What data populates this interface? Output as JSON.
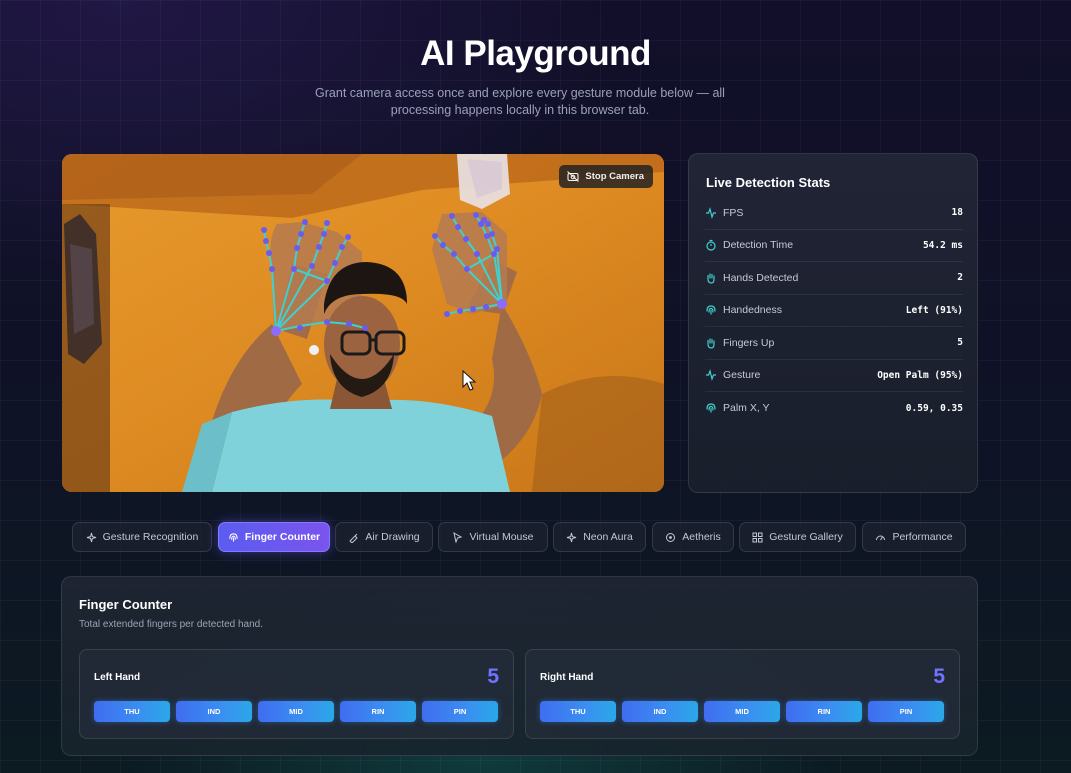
{
  "header": {
    "title": "AI Playground",
    "subtitle": "Grant camera access once and explore every gesture module below — all processing happens locally in this browser tab."
  },
  "camera": {
    "stop_label": "Stop Camera",
    "stop_icon": "camera-off-icon"
  },
  "stats": {
    "title": "Live Detection Stats",
    "rows": [
      {
        "label": "FPS",
        "value": "18",
        "icon": "activity-icon"
      },
      {
        "label": "Detection Time",
        "value": "54.2 ms",
        "icon": "timer-icon"
      },
      {
        "label": "Hands Detected",
        "value": "2",
        "icon": "hand-icon"
      },
      {
        "label": "Handedness",
        "value": "Left (91%)",
        "icon": "fingerprint-icon"
      },
      {
        "label": "Fingers Up",
        "value": "5",
        "icon": "hand-icon"
      },
      {
        "label": "Gesture",
        "value": "Open Palm (95%)",
        "icon": "activity-icon"
      },
      {
        "label": "Palm X, Y",
        "value": "0.59, 0.35",
        "icon": "fingerprint-icon"
      }
    ]
  },
  "tabs": [
    {
      "label": "Gesture Recognition",
      "icon": "sparkles-icon",
      "active": false
    },
    {
      "label": "Finger Counter",
      "icon": "fingerprint-icon",
      "active": true
    },
    {
      "label": "Air Drawing",
      "icon": "brush-icon",
      "active": false
    },
    {
      "label": "Virtual Mouse",
      "icon": "cursor-icon",
      "active": false
    },
    {
      "label": "Neon Aura",
      "icon": "spark-icon",
      "active": false
    },
    {
      "label": "Aetheris",
      "icon": "orbit-icon",
      "active": false
    },
    {
      "label": "Gesture Gallery",
      "icon": "grid-icon",
      "active": false
    },
    {
      "label": "Performance",
      "icon": "gauge-icon",
      "active": false
    }
  ],
  "finger_counter": {
    "title": "Finger Counter",
    "description": "Total extended fingers per detected hand.",
    "hands": [
      {
        "label": "Left Hand",
        "count": "5",
        "fingers": [
          "THU",
          "IND",
          "MID",
          "RIN",
          "PIN"
        ]
      },
      {
        "label": "Right Hand",
        "count": "5",
        "fingers": [
          "THU",
          "IND",
          "MID",
          "RIN",
          "PIN"
        ]
      }
    ]
  },
  "colors": {
    "accent": "#6f73ff",
    "landmark_line": "#3fd0d0",
    "landmark_point": "#6a5cf0",
    "finger_pill": "#3a8ff0"
  }
}
